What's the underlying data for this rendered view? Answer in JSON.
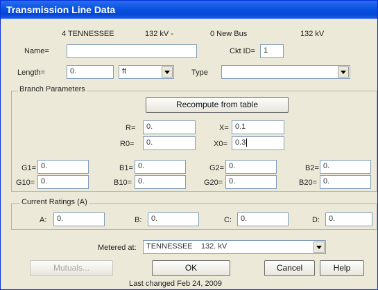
{
  "window": {
    "title": "Transmission Line Data"
  },
  "header": {
    "from_bus": "4 TENNESSEE",
    "from_kv": "132 kV -",
    "to_bus": "0 New Bus",
    "to_kv": "132 kV"
  },
  "fields": {
    "name_label": "Name=",
    "name_value": "",
    "ckt_label": "Ckt ID=",
    "ckt_value": "1",
    "length_label": "Length=",
    "length_value": "0.",
    "unit_selected": "ft",
    "type_label": "Type",
    "type_value": ""
  },
  "branch": {
    "legend": "Branch Parameters",
    "recompute_label": "Recompute from table",
    "r_label": "R=",
    "r_value": "0.",
    "x_label": "X=",
    "x_value": "0.1",
    "r0_label": "R0=",
    "r0_value": "0.",
    "x0_label": "X0=",
    "x0_value": "0.3",
    "g1_label": "G1=",
    "g1_value": "0.",
    "b1_label": "B1=",
    "b1_value": "0.",
    "g2_label": "G2=",
    "g2_value": "0.",
    "b2_label": "B2=",
    "b2_value": "0.",
    "g10_label": "G10=",
    "g10_value": "0.",
    "b10_label": "B10=",
    "b10_value": "0.",
    "g20_label": "G20=",
    "g20_value": "0.",
    "b20_label": "B20=",
    "b20_value": "0."
  },
  "ratings": {
    "legend": "Current Ratings (A)",
    "a_label": "A:",
    "a_value": "0.",
    "b_label": "B:",
    "b_value": "0.",
    "c_label": "C:",
    "c_value": "0.",
    "d_label": "D:",
    "d_value": "0."
  },
  "metered": {
    "label": "Metered at:",
    "value": "TENNESSEE    132. kV"
  },
  "buttons": {
    "mutuals": "Mutuals...",
    "ok": "OK",
    "cancel": "Cancel",
    "help": "Help"
  },
  "footer": {
    "last_changed": "Last changed Feb 24, 2009"
  },
  "colors": {
    "title_bar": "#0a54e0",
    "dialog_bg": "#ece9d8"
  }
}
